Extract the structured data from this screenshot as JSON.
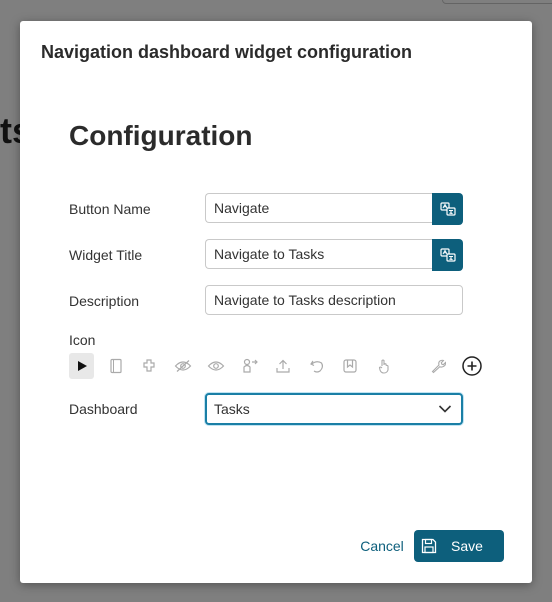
{
  "background": {
    "partial_text": "ts"
  },
  "dialog": {
    "title": "Navigation dashboard widget configuration",
    "heading": "Configuration",
    "fields": {
      "button_name": {
        "label": "Button Name",
        "value": "Navigate"
      },
      "widget_title": {
        "label": "Widget Title",
        "value": "Navigate to Tasks"
      },
      "description": {
        "label": "Description",
        "value": "Navigate to Tasks description"
      },
      "icon": {
        "label": "Icon",
        "options": [
          "play-icon",
          "book-icon",
          "puzzle-icon",
          "eye-off-icon",
          "eye-icon",
          "user-share-icon",
          "upload-icon",
          "undo-icon",
          "bookmark-icon",
          "hand-pointer-icon",
          "wrench-icon",
          "add-circle-icon"
        ],
        "selected": "play-icon"
      },
      "dashboard": {
        "label": "Dashboard",
        "value": "Tasks"
      }
    },
    "actions": {
      "cancel_label": "Cancel",
      "save_label": "Save"
    }
  },
  "colors": {
    "primary": "#0d5f7c",
    "focus_border": "#1a7fa6",
    "overlay": "rgba(0,0,0,0.5)"
  }
}
